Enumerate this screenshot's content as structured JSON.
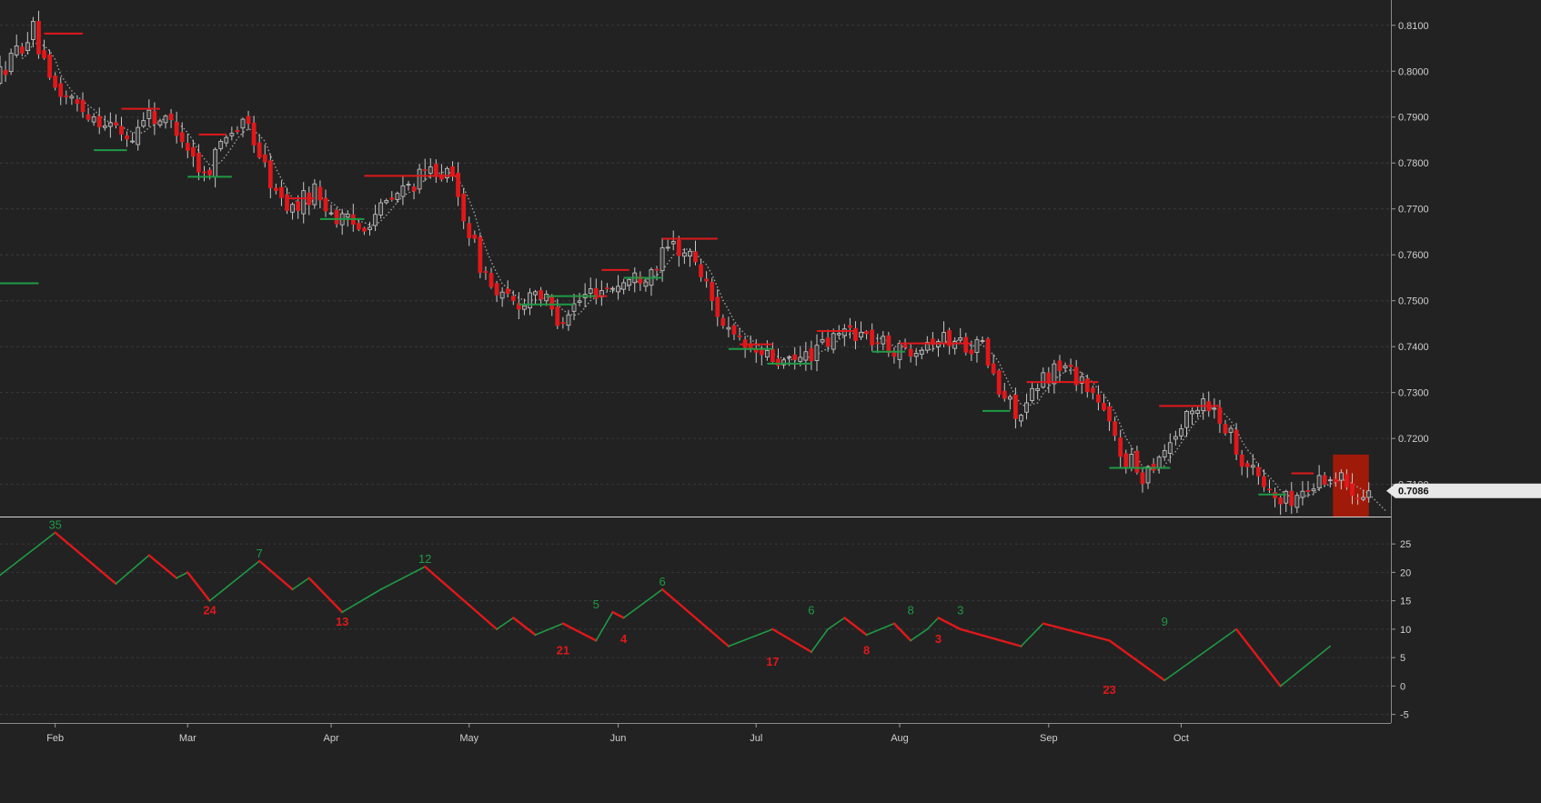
{
  "colors": {
    "background": "#222222",
    "grid": "#3a3a3a",
    "axis_text": "#cfcfcf",
    "bear": "#e0181b",
    "bull": "#3b3b3b",
    "wick": "#c8c8c8",
    "resistance": "#e0181b",
    "support": "#1f9a45",
    "ma": "#a0a0a0",
    "zigzag_up": "#1f9a45",
    "zigzag_down": "#e0181b",
    "current_box": "#a01a0a",
    "price_tag_bg": "#e8e8e8"
  },
  "chart_data": [
    {
      "type": "candlestick",
      "name": "price",
      "ylim": [
        0.703,
        0.8155
      ],
      "y_ticks": [
        {
          "value": 0.71,
          "label": "0.7100"
        },
        {
          "value": 0.72,
          "label": "0.7200"
        },
        {
          "value": 0.73,
          "label": "0.7300"
        },
        {
          "value": 0.74,
          "label": "0.7400"
        },
        {
          "value": 0.75,
          "label": "0.7500"
        },
        {
          "value": 0.76,
          "label": "0.7600"
        },
        {
          "value": 0.77,
          "label": "0.7700"
        },
        {
          "value": 0.78,
          "label": "0.7800"
        },
        {
          "value": 0.79,
          "label": "0.7900"
        },
        {
          "value": 0.8,
          "label": "0.8000"
        },
        {
          "value": 0.81,
          "label": "0.8100"
        }
      ],
      "last_price": {
        "value": 0.7086,
        "label": "0.7086"
      },
      "path": [
        [
          0,
          0.798
        ],
        [
          7,
          0.809
        ],
        [
          10,
          0.797
        ],
        [
          17,
          0.791
        ],
        [
          20,
          0.789
        ],
        [
          25,
          0.785
        ],
        [
          27,
          0.791
        ],
        [
          33,
          0.788
        ],
        [
          38,
          0.777
        ],
        [
          42,
          0.787
        ],
        [
          46,
          0.788
        ],
        [
          51,
          0.773
        ],
        [
          54,
          0.77
        ],
        [
          58,
          0.774
        ],
        [
          62,
          0.768
        ],
        [
          66,
          0.766
        ],
        [
          69,
          0.769
        ],
        [
          75,
          0.775
        ],
        [
          80,
          0.779
        ],
        [
          83,
          0.776
        ],
        [
          88,
          0.758
        ],
        [
          91,
          0.751
        ],
        [
          95,
          0.749
        ],
        [
          98,
          0.753
        ],
        [
          102,
          0.746
        ],
        [
          108,
          0.752
        ],
        [
          114,
          0.754
        ],
        [
          118,
          0.756
        ],
        [
          123,
          0.762
        ],
        [
          127,
          0.759
        ],
        [
          130,
          0.75
        ],
        [
          134,
          0.741
        ],
        [
          139,
          0.738
        ],
        [
          144,
          0.736
        ],
        [
          150,
          0.74
        ],
        [
          155,
          0.744
        ],
        [
          160,
          0.741
        ],
        [
          164,
          0.739
        ],
        [
          170,
          0.742
        ],
        [
          175,
          0.741
        ],
        [
          179,
          0.74
        ],
        [
          182,
          0.73
        ],
        [
          186,
          0.725
        ],
        [
          190,
          0.733
        ],
        [
          193,
          0.736
        ],
        [
          197,
          0.733
        ],
        [
          200,
          0.728
        ],
        [
          204,
          0.717
        ],
        [
          208,
          0.712
        ],
        [
          212,
          0.718
        ],
        [
          216,
          0.724
        ],
        [
          219,
          0.729
        ],
        [
          223,
          0.723
        ],
        [
          226,
          0.716
        ],
        [
          230,
          0.71
        ],
        [
          233,
          0.706
        ],
        [
          237,
          0.708
        ],
        [
          241,
          0.712
        ],
        [
          244,
          0.711
        ],
        [
          248,
          0.708
        ],
        [
          250,
          0.707
        ]
      ],
      "resistance_levels": [
        {
          "x": [
            8,
            15
          ],
          "y": 0.8082
        },
        {
          "x": [
            22,
            29
          ],
          "y": 0.7918
        },
        {
          "x": [
            36,
            41
          ],
          "y": 0.7862
        },
        {
          "x": [
            52,
            57
          ],
          "y": 0.7723
        },
        {
          "x": [
            66,
            83
          ],
          "y": 0.7772
        },
        {
          "x": [
            104,
            110
          ],
          "y": 0.751
        },
        {
          "x": [
            109,
            114
          ],
          "y": 0.7567
        },
        {
          "x": [
            120,
            130
          ],
          "y": 0.7635
        },
        {
          "x": [
            134,
            140
          ],
          "y": 0.7405
        },
        {
          "x": [
            148,
            155
          ],
          "y": 0.7434
        },
        {
          "x": [
            163,
            176
          ],
          "y": 0.7407
        },
        {
          "x": [
            186,
            199
          ],
          "y": 0.7323
        },
        {
          "x": [
            210,
            221
          ],
          "y": 0.7271
        },
        {
          "x": [
            234,
            238
          ],
          "y": 0.7124
        }
      ],
      "support_levels": [
        {
          "x": [
            -15,
            7
          ],
          "y": 0.7538
        },
        {
          "x": [
            17,
            23
          ],
          "y": 0.7828
        },
        {
          "x": [
            34,
            42
          ],
          "y": 0.777
        },
        {
          "x": [
            58,
            66
          ],
          "y": 0.7678
        },
        {
          "x": [
            94,
            104
          ],
          "y": 0.7492
        },
        {
          "x": [
            99,
            108
          ],
          "y": 0.751
        },
        {
          "x": [
            113,
            120
          ],
          "y": 0.755
        },
        {
          "x": [
            132,
            140
          ],
          "y": 0.7395
        },
        {
          "x": [
            139,
            147
          ],
          "y": 0.7363
        },
        {
          "x": [
            158,
            164
          ],
          "y": 0.7389
        },
        {
          "x": [
            178,
            183
          ],
          "y": 0.726
        },
        {
          "x": [
            201,
            212
          ],
          "y": 0.7136
        },
        {
          "x": [
            228,
            233
          ],
          "y": 0.7078
        }
      ],
      "current_box": {
        "x": [
          241.5,
          248
        ],
        "y": [
          0.703,
          0.7165
        ]
      }
    },
    {
      "type": "line",
      "name": "zigzag",
      "ylim": [
        -6.5,
        29.5
      ],
      "y_ticks": [
        {
          "value": -5,
          "label": "-5"
        },
        {
          "value": 0,
          "label": "0"
        },
        {
          "value": 5,
          "label": "5"
        },
        {
          "value": 10,
          "label": "10"
        },
        {
          "value": 15,
          "label": "15"
        },
        {
          "value": 20,
          "label": "20"
        },
        {
          "value": 25,
          "label": "25"
        }
      ],
      "x": [
        -10,
        10,
        21,
        27,
        32,
        34,
        38,
        47,
        53,
        56,
        62,
        69,
        77,
        90,
        93,
        97,
        102,
        108,
        111,
        113,
        120,
        132,
        140,
        147,
        150,
        153,
        157,
        162,
        165,
        168,
        170,
        174,
        185,
        189,
        201,
        211,
        224,
        232,
        241
      ],
      "values": [
        12,
        27,
        18,
        23,
        19,
        20,
        15,
        22,
        17,
        19,
        13,
        17,
        21,
        10,
        12,
        9,
        11,
        8,
        13,
        12,
        17,
        7,
        10,
        6,
        10,
        12,
        9,
        11,
        8,
        10,
        12,
        10,
        7,
        11,
        8,
        1,
        10,
        0,
        7,
        1
      ],
      "labels": [
        {
          "x": 10,
          "y": 27,
          "text": "35",
          "pos": "above"
        },
        {
          "x": 38,
          "y": 15,
          "text": "24",
          "pos": "below"
        },
        {
          "x": 47,
          "y": 22,
          "text": "7",
          "pos": "above"
        },
        {
          "x": 62,
          "y": 13,
          "text": "13",
          "pos": "below"
        },
        {
          "x": 77,
          "y": 21,
          "text": "12",
          "pos": "above"
        },
        {
          "x": 102,
          "y": 8,
          "text": "21",
          "pos": "below"
        },
        {
          "x": 108,
          "y": 13,
          "text": "5",
          "pos": "above"
        },
        {
          "x": 113,
          "y": 10,
          "text": "4",
          "pos": "below"
        },
        {
          "x": 120,
          "y": 17,
          "text": "6",
          "pos": "above"
        },
        {
          "x": 140,
          "y": 6,
          "text": "17",
          "pos": "below"
        },
        {
          "x": 147,
          "y": 12,
          "text": "6",
          "pos": "above"
        },
        {
          "x": 157,
          "y": 8,
          "text": "8",
          "pos": "below"
        },
        {
          "x": 165,
          "y": 12,
          "text": "8",
          "pos": "above"
        },
        {
          "x": 170,
          "y": 10,
          "text": "3",
          "pos": "below"
        },
        {
          "x": 174,
          "y": 12,
          "text": "3",
          "pos": "above"
        },
        {
          "x": 201,
          "y": 1,
          "text": "23",
          "pos": "below"
        },
        {
          "x": 211,
          "y": 10,
          "text": "9",
          "pos": "above"
        }
      ]
    }
  ],
  "x_axis": {
    "months": [
      {
        "x": 10,
        "label": "Feb"
      },
      {
        "x": 34,
        "label": "Mar"
      },
      {
        "x": 60,
        "label": "Apr"
      },
      {
        "x": 85,
        "label": "May"
      },
      {
        "x": 112,
        "label": "Jun"
      },
      {
        "x": 137,
        "label": "Jul"
      },
      {
        "x": 163,
        "label": "Aug"
      },
      {
        "x": 190,
        "label": "Sep"
      },
      {
        "x": 214,
        "label": "Oct"
      }
    ]
  }
}
